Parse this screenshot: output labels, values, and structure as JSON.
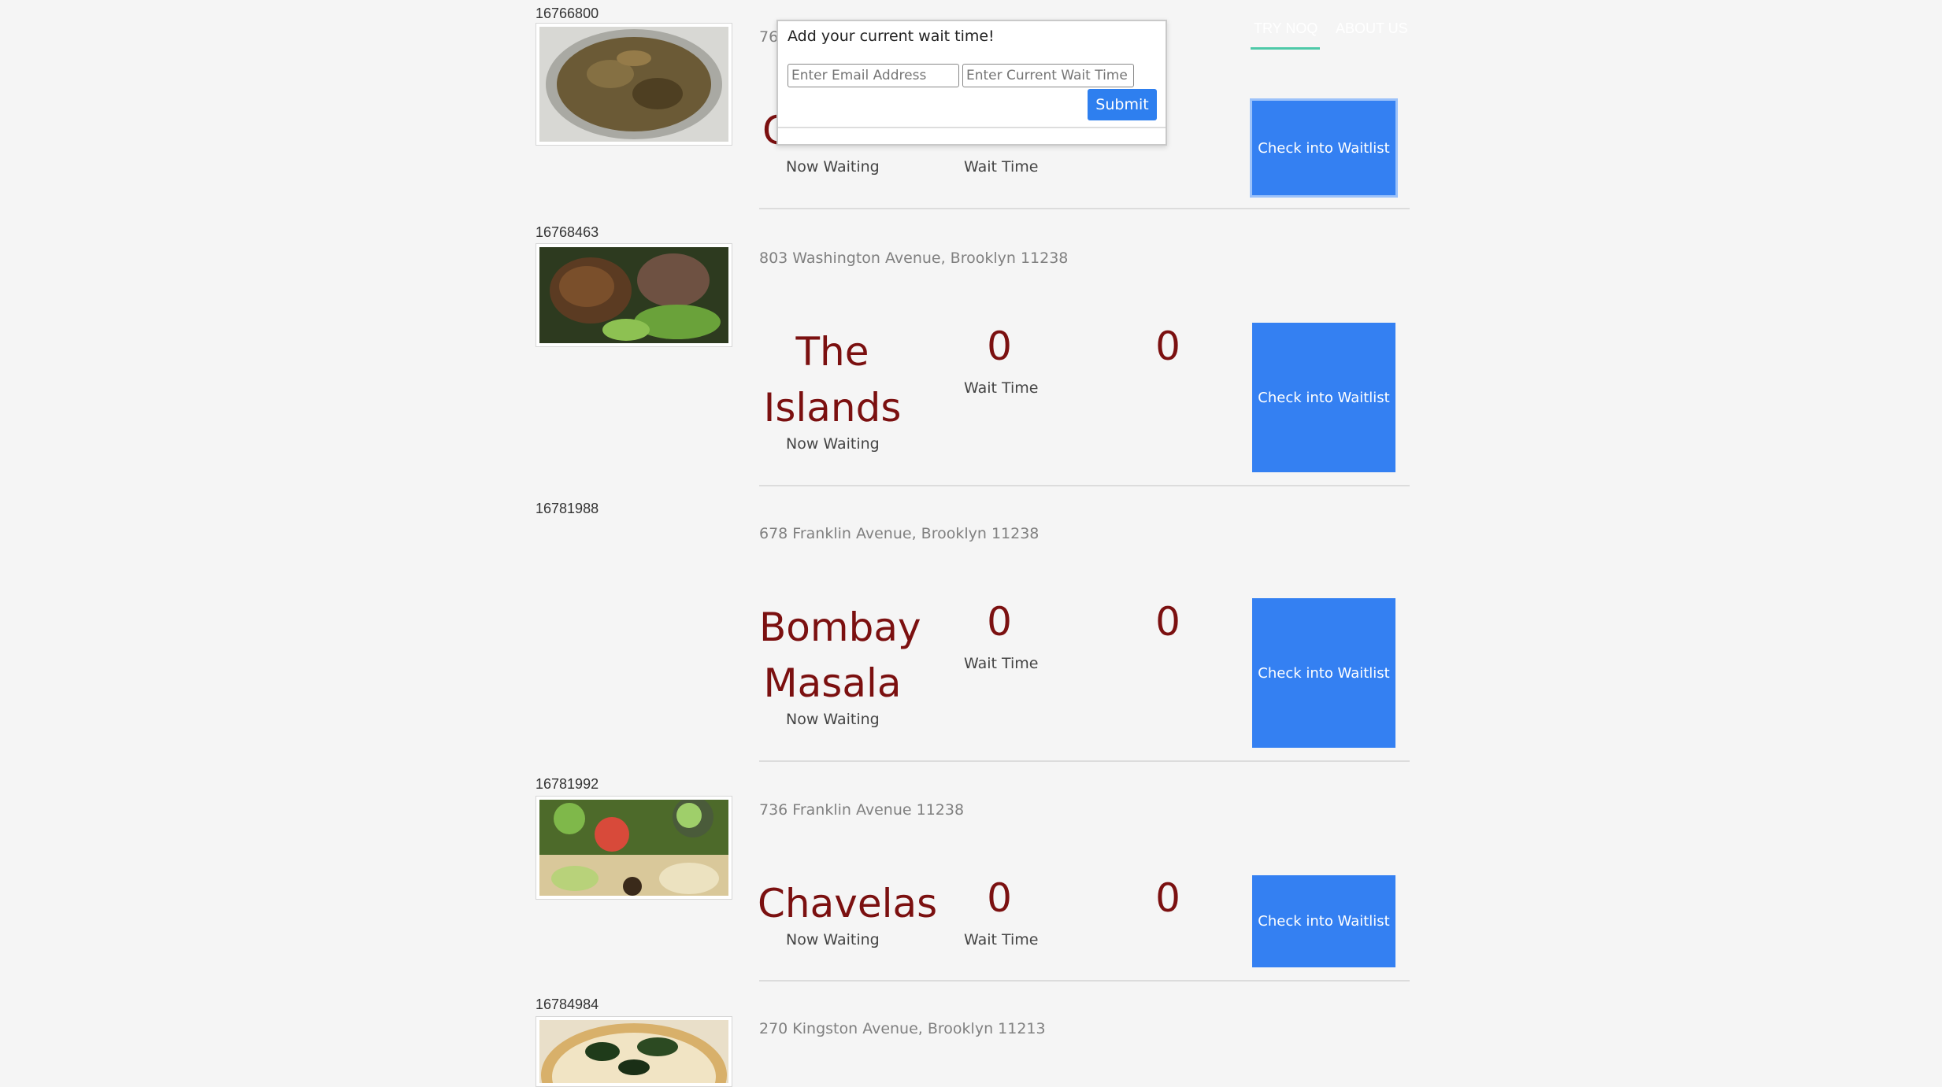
{
  "nav": {
    "try_label": "TRY NOQ",
    "about_label": "ABOUT US"
  },
  "popup": {
    "title": "Add your current wait time!",
    "email_placeholder": "Enter Email Address",
    "wait_placeholder": "Enter Current Wait Time",
    "submit_label": "Submit"
  },
  "labels": {
    "now_waiting": "Now Waiting",
    "wait_time": "Wait Time",
    "check_in": "Check into Waitlist"
  },
  "restaurants": [
    {
      "id": "16766800",
      "address_partial": "76",
      "name_partial": "C",
      "now_waiting": "",
      "wait_time": "",
      "third_partial": "0"
    },
    {
      "id": "16768463",
      "address": "803 Washington Avenue, Brooklyn 11238",
      "name_line1": "The",
      "name_line2": "Islands",
      "wait_time": "0",
      "third": "0"
    },
    {
      "id": "16781988",
      "address": "678 Franklin Avenue, Brooklyn 11238",
      "name_line1": "Bombay",
      "name_line2": "Masala",
      "wait_time": "0",
      "third": "0"
    },
    {
      "id": "16781992",
      "address": "736 Franklin Avenue 11238",
      "name_line1": "Chavelas",
      "wait_time": "0",
      "third": "0"
    },
    {
      "id": "16784984",
      "address": "270 Kingston Avenue, Brooklyn 11213"
    }
  ]
}
